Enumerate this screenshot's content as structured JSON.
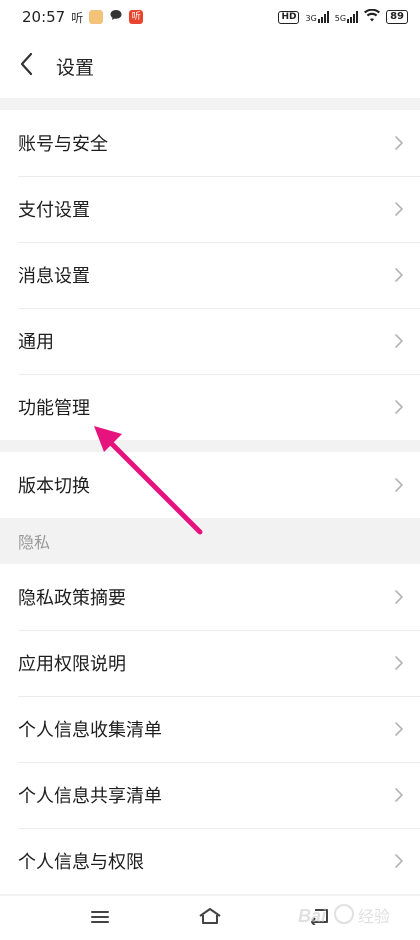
{
  "status_bar": {
    "time": "20:57",
    "notif_text": "听",
    "notif_badge": "听",
    "hd": "HD",
    "net_3g": "3G",
    "net_5g": "5G",
    "battery": "89"
  },
  "header": {
    "title": "设置",
    "back_icon": "chevron-left-icon"
  },
  "groups": [
    {
      "items": [
        {
          "label": "账号与安全"
        },
        {
          "label": "支付设置"
        },
        {
          "label": "消息设置"
        },
        {
          "label": "通用"
        },
        {
          "label": "功能管理"
        }
      ]
    },
    {
      "items": [
        {
          "label": "版本切换"
        }
      ]
    },
    {
      "title": "隐私",
      "items": [
        {
          "label": "隐私政策摘要"
        },
        {
          "label": "应用权限说明"
        },
        {
          "label": "个人信息收集清单"
        },
        {
          "label": "个人信息共享清单"
        },
        {
          "label": "个人信息与权限"
        }
      ]
    }
  ],
  "nav_bar": {
    "menu_icon": "menu-icon",
    "home_icon": "home-icon",
    "back_icon": "back-icon"
  },
  "annotation": {
    "color": "#e6137e"
  },
  "watermark": {
    "text": "经验",
    "brand": "Bai"
  }
}
